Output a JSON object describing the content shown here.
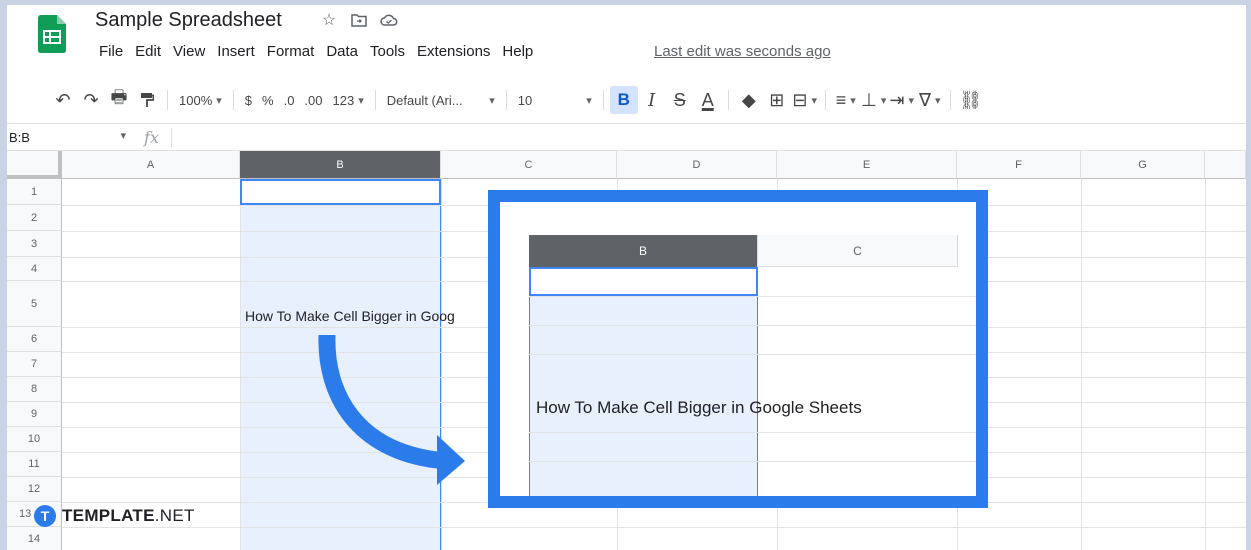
{
  "app": {
    "title": "Sample Spreadsheet",
    "menu": [
      "File",
      "Edit",
      "View",
      "Insert",
      "Format",
      "Data",
      "Tools",
      "Extensions",
      "Help"
    ],
    "last_edit": "Last edit was seconds ago",
    "accent_color": "#2b7bea"
  },
  "toolbar": {
    "zoom": "100%",
    "currency": "$",
    "percent": "%",
    "decrease_decimal": ".0",
    "increase_decimal": ".00",
    "number_format": "123",
    "font": "Default (Ari...",
    "font_size": "10",
    "bold": "B",
    "italic": "I",
    "strike": "S",
    "text_color": "A"
  },
  "formula_bar": {
    "name_box": "B:B",
    "fx": "fx"
  },
  "grid": {
    "columns": [
      "A",
      "B",
      "C",
      "D",
      "E",
      "F",
      "G"
    ],
    "selected_column": "B",
    "rows": [
      "1",
      "2",
      "3",
      "4",
      "5",
      "6",
      "7",
      "8",
      "9",
      "10",
      "11",
      "12",
      "13",
      "14"
    ],
    "cell_b5": "How To Make Cell Bigger in Goog"
  },
  "zoom_view": {
    "columns": [
      "B",
      "C"
    ],
    "cell_text": "How To Make Cell Bigger in Google Sheets"
  },
  "watermark": {
    "badge": "T",
    "brand_bold": "TEMPLATE",
    "brand_thin": ".NET"
  }
}
